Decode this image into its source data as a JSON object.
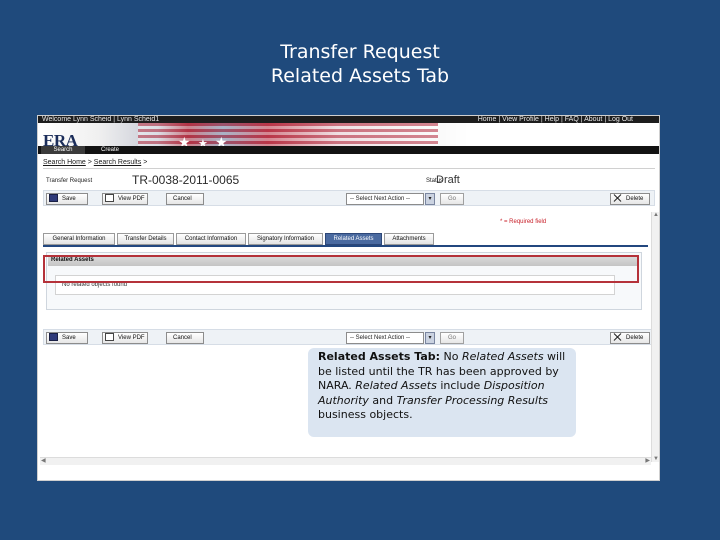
{
  "slide": {
    "title_line1": "Transfer Request",
    "title_line2": "Related Assets Tab"
  },
  "app": {
    "user_text": "Welcome Lynn Scheid | Lynn Scheid1",
    "top_links": "Home | View Profile | Help | FAQ | About | Log Out",
    "logo": "ERA",
    "nav": {
      "search": "Search",
      "create": "Create"
    },
    "breadcrumb": {
      "home": "Search Home",
      "sep": " > ",
      "results": "Search Results",
      "tail": " >"
    },
    "record": {
      "type_label": "Transfer Request",
      "number": "TR-0038-2011-0065",
      "status_label": "Status",
      "status_value": "Draft"
    },
    "toolbar": {
      "save": "Save",
      "view_pdf": "View PDF",
      "cancel": "Cancel",
      "next_action": "-- Select Next Action --",
      "select_arrow": "▾",
      "go": "Go",
      "delete": "Delete"
    },
    "required_note": "* = Required field",
    "tabs": [
      "General Information",
      "Transfer Details",
      "Contact Information",
      "Signatory Information",
      "Related Assets",
      "Attachments"
    ],
    "active_tab": "Related Assets",
    "section": {
      "title": "Related Assets",
      "empty_message": "No related objects found"
    }
  },
  "callout": {
    "lead": "Related Assets Tab:",
    "t1": " No ",
    "i1": "Related Assets",
    "t2": " will be listed until the TR has been approved by NARA.  ",
    "i2": "Related Assets",
    "t3": " include ",
    "i3": "Disposition Authority",
    "t4": " and ",
    "i4": "Transfer Processing Results",
    "t5": " business objects."
  }
}
